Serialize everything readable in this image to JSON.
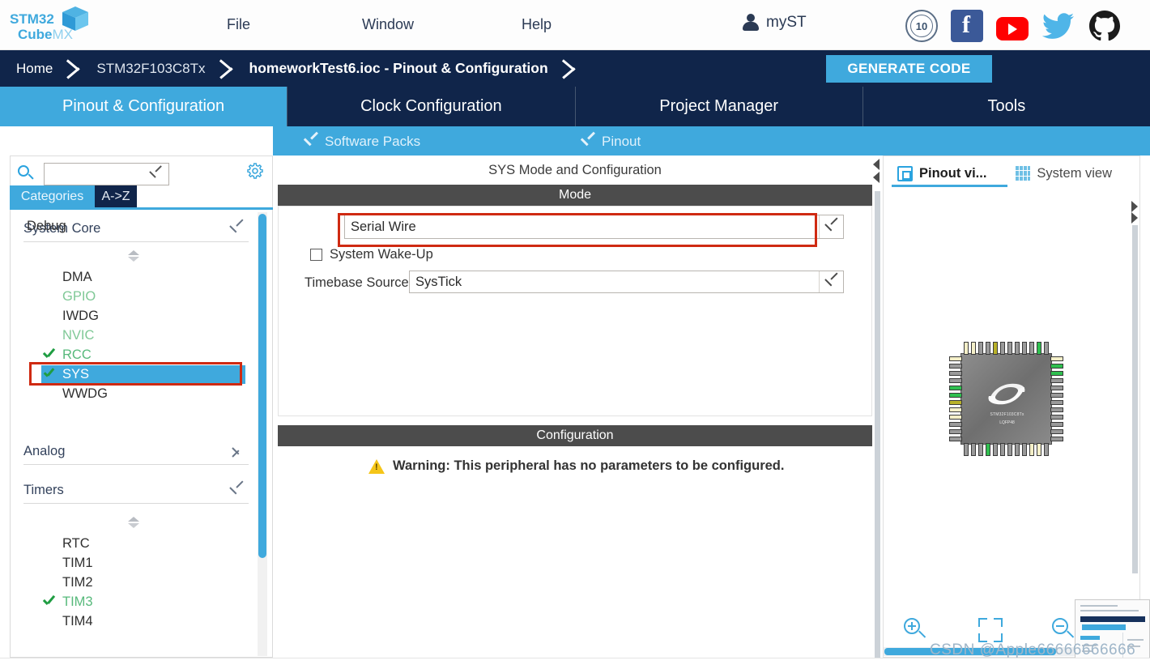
{
  "app": {
    "logo_top": "STM32",
    "logo_bottom": "Cube",
    "logo_suffix": "MX"
  },
  "menu": {
    "items": [
      {
        "label": "File",
        "name": "menu-file"
      },
      {
        "label": "Window",
        "name": "menu-window"
      },
      {
        "label": "Help",
        "name": "menu-help"
      }
    ],
    "account_label": "myST",
    "badge_label": "10",
    "social": [
      {
        "name": "anniversary-badge-icon",
        "label": "10"
      },
      {
        "name": "facebook-icon",
        "label": "f"
      },
      {
        "name": "youtube-icon",
        "label": ""
      },
      {
        "name": "twitter-icon",
        "label": ""
      },
      {
        "name": "github-icon",
        "label": ""
      }
    ]
  },
  "breadcrumb": {
    "home": "Home",
    "device": "STM32F103C8Tx",
    "file": "homeworkTest6.ioc - Pinout & Configuration",
    "generate_code": "GENERATE CODE"
  },
  "main_tabs": [
    {
      "label": "Pinout & Configuration",
      "active": true
    },
    {
      "label": "Clock Configuration",
      "active": false
    },
    {
      "label": "Project Manager",
      "active": false
    },
    {
      "label": "Tools",
      "active": false
    }
  ],
  "subbar": {
    "software_packs": "Software Packs",
    "pinout": "Pinout"
  },
  "sidebar": {
    "search_value": "",
    "search_placeholder": "",
    "tabs": [
      {
        "label": "Categories",
        "active": true
      },
      {
        "label": "A->Z",
        "active": false
      }
    ],
    "groups": [
      {
        "name": "System Core",
        "expanded": true,
        "items": [
          {
            "label": "DMA",
            "state": "none"
          },
          {
            "label": "GPIO",
            "state": "partial"
          },
          {
            "label": "IWDG",
            "state": "none"
          },
          {
            "label": "NVIC",
            "state": "partial"
          },
          {
            "label": "RCC",
            "state": "checked"
          },
          {
            "label": "SYS",
            "state": "checked",
            "selected": true
          },
          {
            "label": "WWDG",
            "state": "none"
          }
        ]
      },
      {
        "name": "Analog",
        "expanded": false,
        "items": []
      },
      {
        "name": "Timers",
        "expanded": true,
        "items": [
          {
            "label": "RTC",
            "state": "none"
          },
          {
            "label": "TIM1",
            "state": "none"
          },
          {
            "label": "TIM2",
            "state": "none"
          },
          {
            "label": "TIM3",
            "state": "checked"
          },
          {
            "label": "TIM4",
            "state": "none"
          }
        ]
      }
    ]
  },
  "center": {
    "title": "SYS Mode and Configuration",
    "mode_band": "Mode",
    "config_band": "Configuration",
    "debug_label": "Debug",
    "debug_value": "Serial Wire",
    "wakeup_label": "System Wake-Up",
    "wakeup_checked": false,
    "timebase_label": "Timebase Source",
    "timebase_value": "SysTick",
    "warning_text": "Warning: This peripheral has no parameters to be configured."
  },
  "right_panel": {
    "tabs": [
      {
        "label": "Pinout vi...",
        "active": true,
        "icon": "chip-icon"
      },
      {
        "label": "System view",
        "active": false,
        "icon": "system-view-icon"
      }
    ],
    "chip": {
      "part": "STM32F103C8Tx",
      "package": "LQFP48"
    },
    "zoom_controls": [
      {
        "name": "zoom-in-button",
        "label": "+"
      },
      {
        "name": "fit-to-view-button",
        "label": ""
      },
      {
        "name": "zoom-out-button",
        "label": "-"
      }
    ]
  },
  "watermark": "CSDN @Apple66666666666",
  "colors": {
    "navy": "#10254a",
    "accent_blue": "#3fa9dd",
    "band_gray": "#4c4c4c",
    "highlight_red": "#cf2a12",
    "check_green": "#1f9d42",
    "warn_yellow": "#f5c518"
  }
}
